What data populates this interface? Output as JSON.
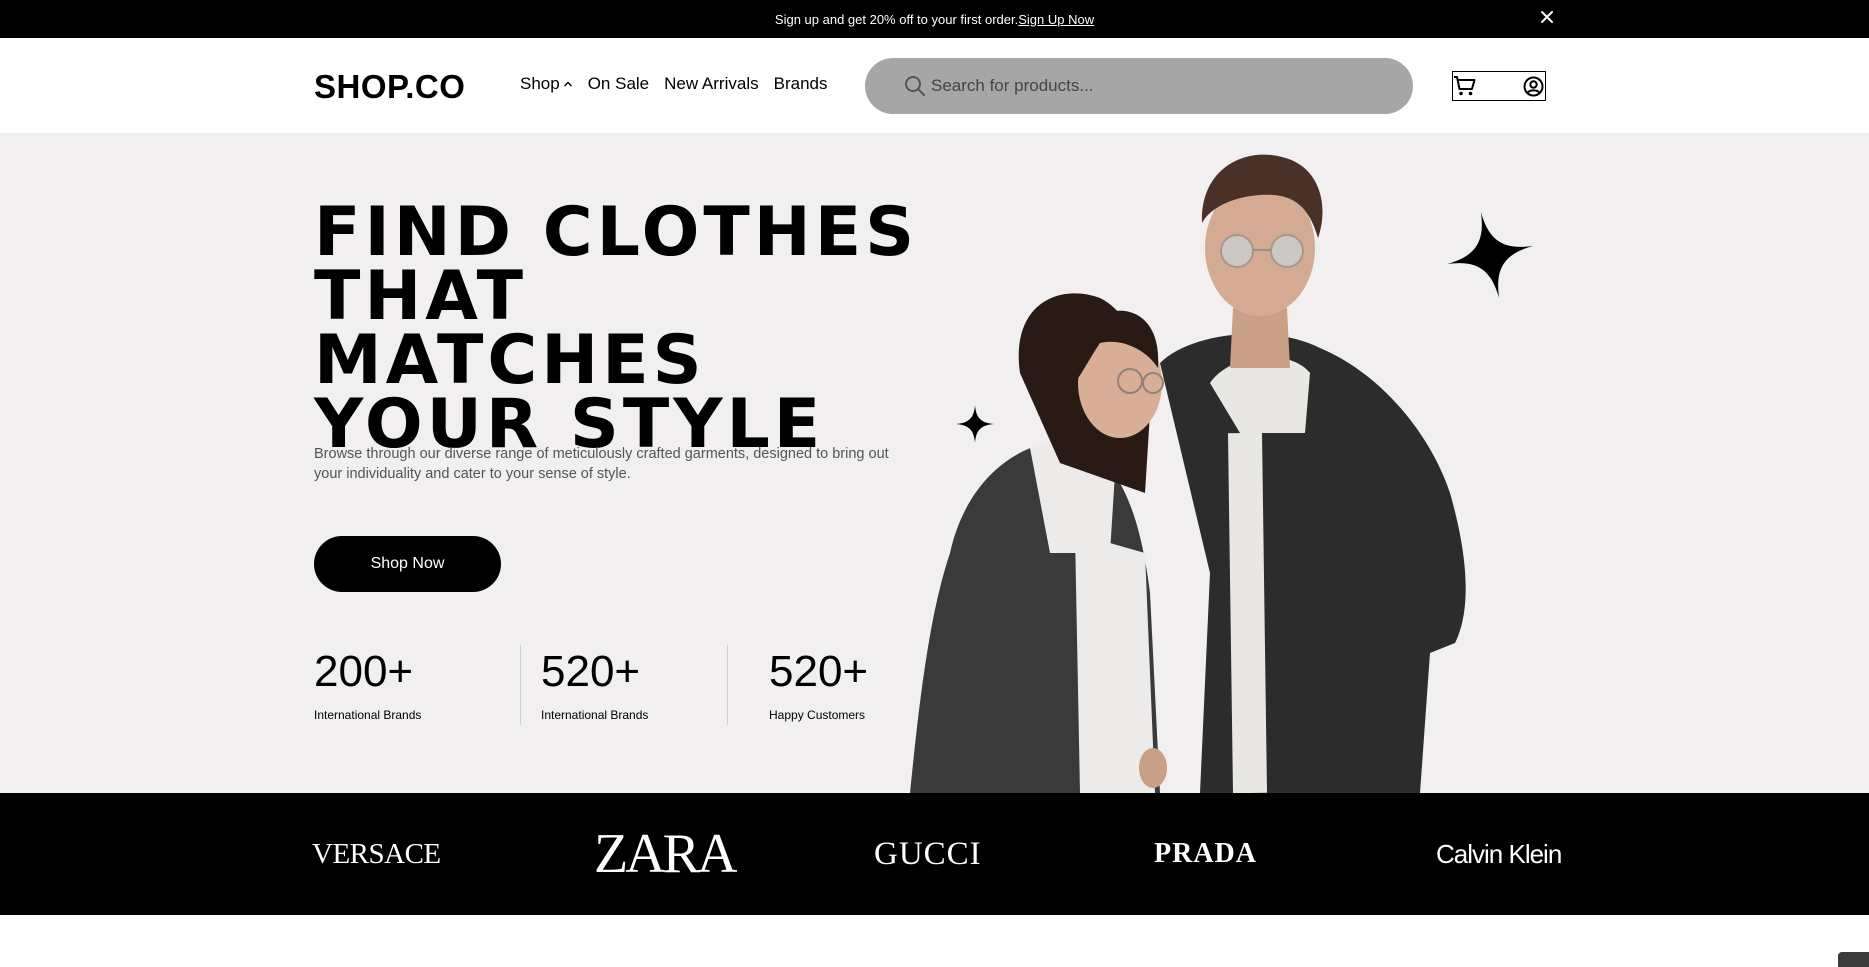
{
  "announcement": {
    "text": "Sign up and get 20% off to your first order.",
    "link_label": "Sign Up Now"
  },
  "header": {
    "logo": "SHOP.CO",
    "nav": [
      {
        "label": "Shop"
      },
      {
        "label": "On Sale"
      },
      {
        "label": "New Arrivals"
      },
      {
        "label": "Brands"
      }
    ],
    "search": {
      "placeholder": "Search for products..."
    }
  },
  "hero": {
    "headline_lines": [
      "FIND CLOTHES",
      "THAT MATCHES",
      "YOUR STYLE"
    ],
    "description": "Browse through our diverse range of meticulously crafted garments, designed to bring out your individuality and cater to your sense of style.",
    "cta_label": "Shop Now",
    "stats": [
      {
        "value": "200+",
        "label": "International Brands"
      },
      {
        "value": "520+",
        "label": "International Brands"
      },
      {
        "value": "520+",
        "label": "Happy Customers"
      }
    ]
  },
  "brands": [
    "VERSACE",
    "ZARA",
    "GUCCI",
    "PRADA",
    "Calvin Klein"
  ],
  "colors": {
    "announcement_bg": "#000000",
    "hero_bg": "#f1efef",
    "search_bg": "#a6a6a6",
    "brands_bg": "#000000",
    "button_bg": "#000000"
  },
  "icons": [
    "close-icon",
    "chevron-up-icon",
    "search-icon",
    "cart-icon",
    "user-icon",
    "star-icon"
  ]
}
